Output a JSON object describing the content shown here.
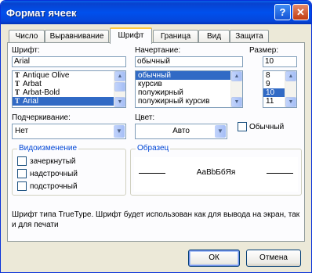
{
  "window": {
    "title": "Формат ячеек"
  },
  "tabs": [
    {
      "label": "Число"
    },
    {
      "label": "Выравнивание"
    },
    {
      "label": "Шрифт"
    },
    {
      "label": "Граница"
    },
    {
      "label": "Вид"
    },
    {
      "label": "Защита"
    }
  ],
  "font": {
    "label": "Шрифт:",
    "value": "Arial",
    "items": [
      {
        "label": "Antique Olive"
      },
      {
        "label": "Arbat"
      },
      {
        "label": "Arbat-Bold"
      },
      {
        "label": "Arial"
      }
    ]
  },
  "style": {
    "label": "Начертание:",
    "value": "обычный",
    "items": [
      {
        "label": "обычный"
      },
      {
        "label": "курсив"
      },
      {
        "label": "полужирный"
      },
      {
        "label": "полужирный курсив"
      }
    ]
  },
  "size": {
    "label": "Размер:",
    "value": "10",
    "items": [
      {
        "label": "8"
      },
      {
        "label": "9"
      },
      {
        "label": "10"
      },
      {
        "label": "11"
      }
    ]
  },
  "underline": {
    "label": "Подчеркивание:",
    "value": "Нет"
  },
  "color": {
    "label": "Цвет:",
    "value": "Авто"
  },
  "normal_font": {
    "label": "Обычный"
  },
  "effects": {
    "title": "Видоизменение",
    "items": [
      {
        "label": "зачеркнутый"
      },
      {
        "label": "надстрочный"
      },
      {
        "label": "подстрочный"
      }
    ]
  },
  "preview": {
    "title": "Образец",
    "sample": "АаВbБбЯя"
  },
  "description": "Шрифт типа TrueType. Шрифт будет использован как для вывода на экран, так и для печати",
  "buttons": {
    "ok": "ОК",
    "cancel": "Отмена"
  }
}
